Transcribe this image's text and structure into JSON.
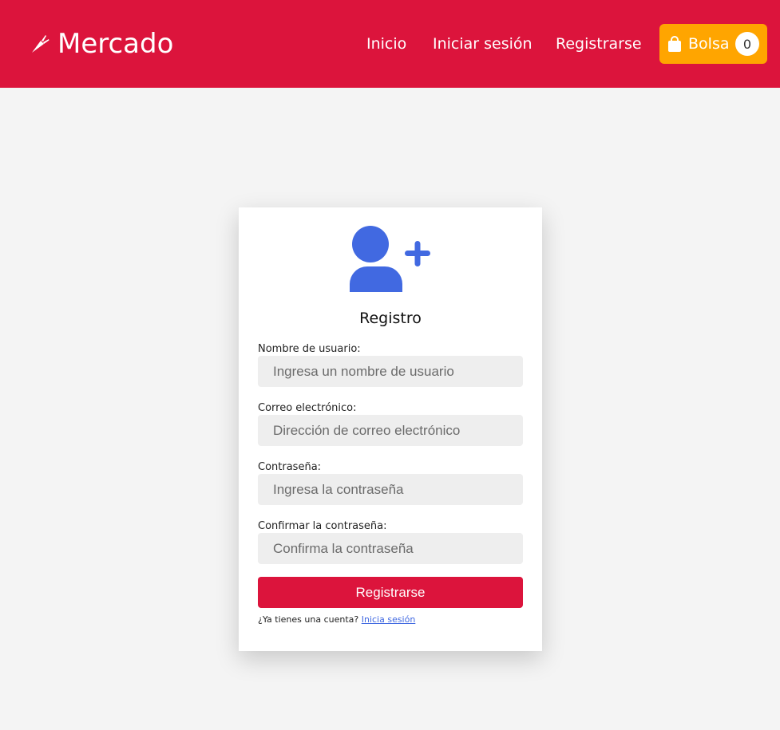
{
  "navbar": {
    "brand": "Mercado",
    "brand_icon": "carrot-icon",
    "links": [
      "Inicio",
      "Iniciar sesión",
      "Registrarse"
    ],
    "bag": {
      "label": "Bolsa",
      "count": "0",
      "icon": "shopping-bag-icon"
    }
  },
  "form": {
    "icon": "user-plus-icon",
    "title": "Registro",
    "username": {
      "label": "Nombre de usuario:",
      "placeholder": "Ingresa un nombre de usuario"
    },
    "email": {
      "label": "Correo electrónico:",
      "placeholder": "Dirección de correo electrónico"
    },
    "password": {
      "label": "Contraseña:",
      "placeholder": "Ingresa la contraseña"
    },
    "confirm": {
      "label": "Confirmar la contraseña:",
      "placeholder": "Confirma la contraseña"
    },
    "submit_label": "Registrarse",
    "login_prompt": "¿Ya tienes una cuenta?",
    "login_link": "Inicia sesión"
  },
  "colors": {
    "primary": "#dc143c",
    "accent": "#ffa500",
    "icon_blue": "#4169e1",
    "background": "#f4f4f4"
  }
}
